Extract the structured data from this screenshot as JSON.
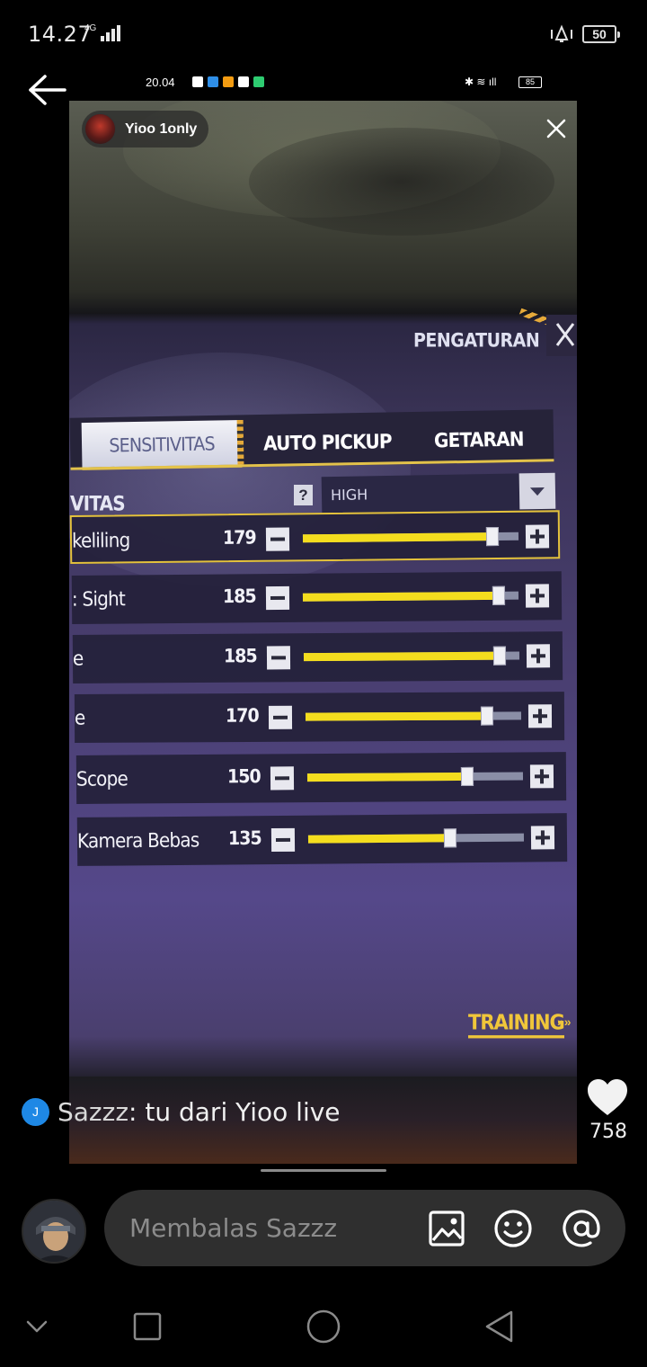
{
  "status_bar": {
    "time": "14.27",
    "network": "4G",
    "battery": "50"
  },
  "story": {
    "author": "Yioo 1only",
    "inner_status": {
      "time": "20.04",
      "battery": "85",
      "app_icon_colors": [
        "#ffffff",
        "#2f8fe8",
        "#f39c12",
        "#ffffff",
        "#2ecc71"
      ]
    },
    "game": {
      "header_title": "PENGATURAN",
      "tabs": [
        {
          "label": "SENSITIVITAS",
          "active": true
        },
        {
          "label": "AUTO PICKUP",
          "active": false
        },
        {
          "label": "GETARAN",
          "active": false
        }
      ],
      "section_label": "VITAS",
      "help_label": "?",
      "preset_value": "HIGH",
      "rows": [
        {
          "label": "keliling",
          "value": "179",
          "fraction": 0.88,
          "selected": true
        },
        {
          "label": ": Sight",
          "value": "185",
          "fraction": 0.91,
          "selected": false
        },
        {
          "label": "e",
          "value": "185",
          "fraction": 0.91,
          "selected": false
        },
        {
          "label": "e",
          "value": "170",
          "fraction": 0.84,
          "selected": false
        },
        {
          "label": "Scope",
          "value": "150",
          "fraction": 0.74,
          "selected": false
        },
        {
          "label": "Kamera Bebas",
          "value": "135",
          "fraction": 0.66,
          "selected": false
        }
      ],
      "training_label": "TRAINING",
      "training_arrows": "»»",
      "accent_color": "#f4dd1e"
    }
  },
  "comment": {
    "badge": "J",
    "user": "Sazzz",
    "separator": ": ",
    "text": "tu dari Yioo live"
  },
  "likes": {
    "count": "758"
  },
  "reply": {
    "placeholder": "Membalas Sazzz"
  },
  "icons": {
    "back": "arrow-left-icon",
    "close": "close-icon",
    "like": "heart-icon",
    "gallery": "image-icon",
    "emoji": "smiley-icon",
    "mention": "at-icon"
  }
}
